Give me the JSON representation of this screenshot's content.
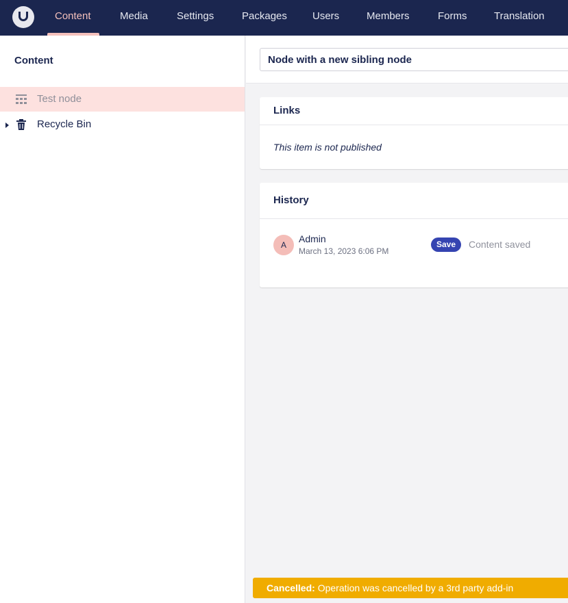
{
  "nav": {
    "items": [
      {
        "label": "Content",
        "active": true
      },
      {
        "label": "Media"
      },
      {
        "label": "Settings"
      },
      {
        "label": "Packages"
      },
      {
        "label": "Users"
      },
      {
        "label": "Members"
      },
      {
        "label": "Forms"
      },
      {
        "label": "Translation"
      }
    ]
  },
  "sidebar": {
    "title": "Content",
    "tree": [
      {
        "label": "Test node",
        "icon": "grid-icon",
        "selected": true
      },
      {
        "label": "Recycle Bin",
        "icon": "trash-icon",
        "expandable": true
      }
    ]
  },
  "editor": {
    "node_name": "Node with a new sibling node"
  },
  "links": {
    "title": "Links",
    "status": "This item is not published"
  },
  "history": {
    "title": "History",
    "entries": [
      {
        "avatar_initial": "A",
        "user": "Admin",
        "date": "March 13, 2023 6:06 PM",
        "badge": "Save",
        "message": "Content saved"
      }
    ]
  },
  "notification": {
    "label": "Cancelled:",
    "message": " Operation was cancelled by a 3rd party add-in"
  },
  "colors": {
    "header_bg": "#1b264f",
    "accent": "#f5c1bc",
    "badge": "#3544b1",
    "warning": "#f0ac00"
  }
}
